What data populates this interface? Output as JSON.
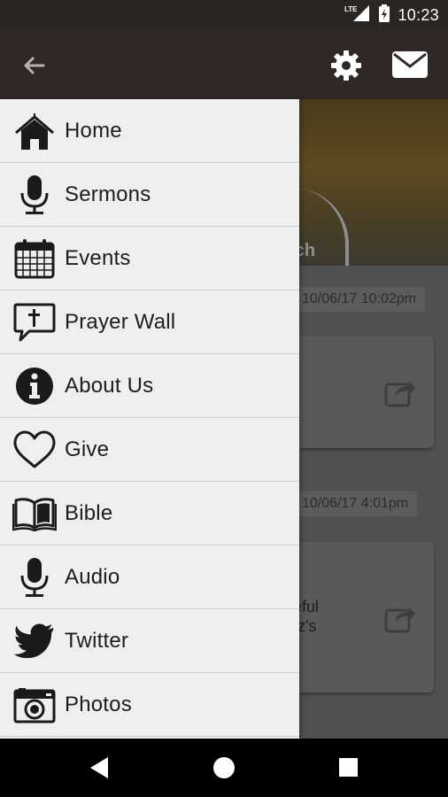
{
  "status": {
    "network": "LTE",
    "time": "10:23"
  },
  "appbar": {
    "back_icon": "arrow-left-icon",
    "settings_icon": "gear-icon",
    "mail_icon": "mail-icon"
  },
  "background": {
    "hero_text": "rch",
    "posts": [
      {
        "date": "10/06/17 10:02pm",
        "text": ""
      },
      {
        "date": "10/06/17 4:01pm",
        "text": "eful\ntz's"
      }
    ]
  },
  "drawer": {
    "items": [
      {
        "label": "Home",
        "icon": "house-icon"
      },
      {
        "label": "Sermons",
        "icon": "microphone-icon"
      },
      {
        "label": "Events",
        "icon": "calendar-icon"
      },
      {
        "label": "Prayer Wall",
        "icon": "speech-bubble-cross-icon"
      },
      {
        "label": "About Us",
        "icon": "info-icon"
      },
      {
        "label": "Give",
        "icon": "heart-icon"
      },
      {
        "label": "Bible",
        "icon": "open-book-icon"
      },
      {
        "label": "Audio",
        "icon": "microphone-icon"
      },
      {
        "label": "Twitter",
        "icon": "twitter-bird-icon"
      },
      {
        "label": "Photos",
        "icon": "camera-icon"
      }
    ]
  },
  "navbar": {
    "back": "nav-back-icon",
    "home": "nav-home-icon",
    "recents": "nav-recents-icon"
  }
}
